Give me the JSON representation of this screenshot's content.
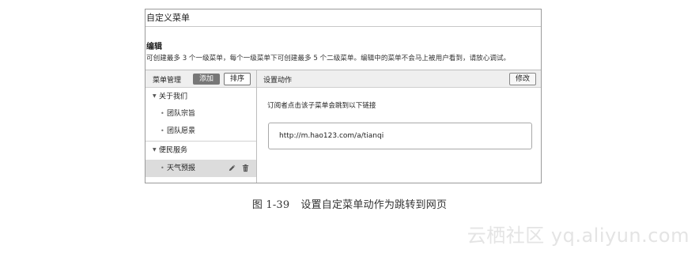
{
  "window": {
    "title": "自定义菜单"
  },
  "section": {
    "title": "编辑",
    "description": "可创建最多 3 个一级菜单，每个一级菜单下可创建最多 5 个二级菜单。编辑中的菜单不会马上被用户看到，请放心调试。"
  },
  "menu_panel": {
    "header_label": "菜单管理",
    "add_label": "添加",
    "sort_label": "排序",
    "groups": [
      {
        "label": "关于我们",
        "items": [
          {
            "label": "团队宗旨"
          },
          {
            "label": "团队愿景"
          }
        ]
      },
      {
        "label": "便民服务",
        "items": [
          {
            "label": "天气预报",
            "selected": true
          }
        ]
      }
    ]
  },
  "action_panel": {
    "header_label": "设置动作",
    "edit_label": "修改",
    "hint": "订阅者点击该子菜单会跳到以下链接",
    "url": "http://m.hao123.com/a/tianqi"
  },
  "caption": {
    "number": "图 1-39",
    "text": "设置自定菜单动作为跳转到网页"
  },
  "watermark": "云栖社区 yq.aliyun.com",
  "icons": {
    "collapse": "caret-down-icon",
    "edit": "pencil-icon",
    "delete": "trash-icon"
  }
}
